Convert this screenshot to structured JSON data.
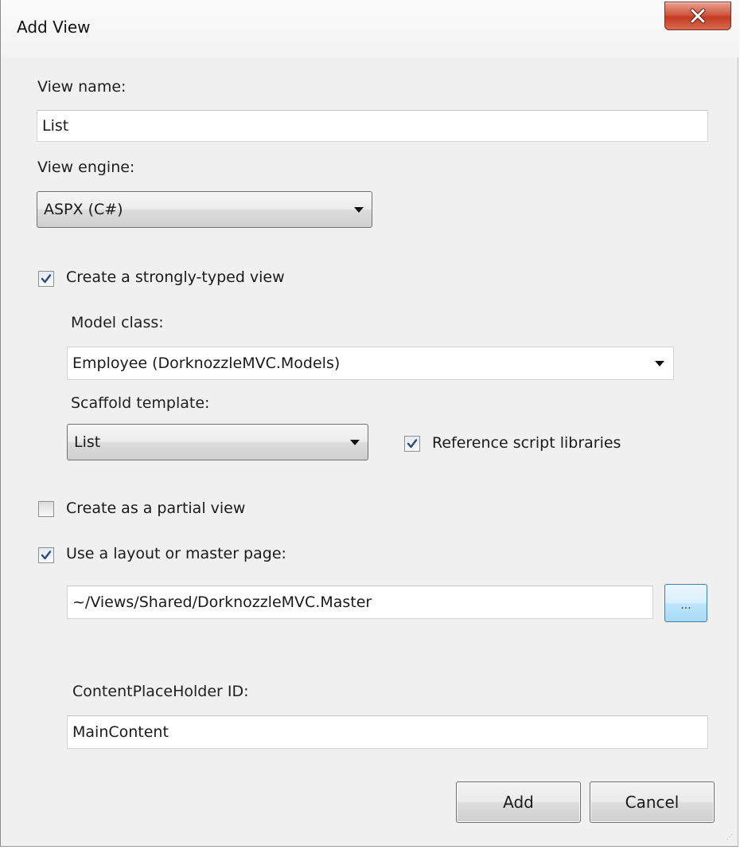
{
  "window": {
    "title": "Add View",
    "close_icon": "close-icon",
    "close_color": "#c43b23"
  },
  "view_name": {
    "label": "View name:",
    "value": "List"
  },
  "view_engine": {
    "label": "View engine:",
    "selected": "ASPX (C#)"
  },
  "strongly_typed": {
    "label": "Create a strongly-typed view",
    "checked": true
  },
  "model_class": {
    "label": "Model class:",
    "selected": "Employee (DorknozzleMVC.Models)"
  },
  "scaffold_template": {
    "label": "Scaffold template:",
    "selected": "List"
  },
  "reference_scripts": {
    "label": "Reference script libraries",
    "checked": true
  },
  "partial_view": {
    "label": "Create as a partial view",
    "checked": false
  },
  "layout_page": {
    "label": "Use a layout or master page:",
    "checked": true,
    "value": "~/Views/Shared/DorknozzleMVC.Master",
    "browse_label": "..."
  },
  "content_placeholder": {
    "label": "ContentPlaceHolder ID:",
    "value": "MainContent"
  },
  "buttons": {
    "add": "Add",
    "cancel": "Cancel"
  }
}
